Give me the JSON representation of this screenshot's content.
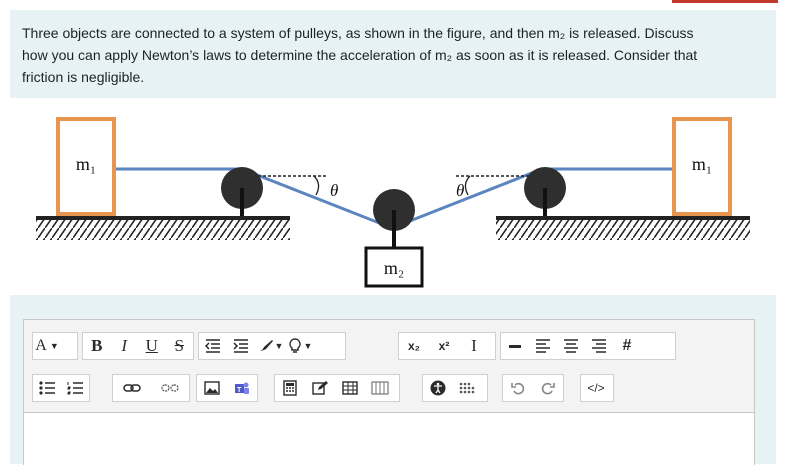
{
  "question": {
    "line1": "Three objects are connected to a system of pulleys, as shown in the figure, and then m₂ is released. Discuss",
    "line2": "how you can apply Newton’s laws to determine the acceleration of m₂ as soon as it is released. Consider that",
    "line3": "friction is negligible."
  },
  "figure": {
    "mass_left": "m₁",
    "mass_right": "m₁",
    "mass_center": "m₂",
    "angle_left": "θ",
    "angle_right": "θ",
    "colors": {
      "block_outline": "#e8964f",
      "rope": "#5b85c0",
      "pulley": "#2f2f2f"
    }
  },
  "toolbar": {
    "font_color_label": "A",
    "bold_label": "B",
    "italic_label": "I",
    "underline_label": "U",
    "strike_label": "S",
    "subscript_label": "x₂",
    "superscript_label": "x²",
    "clear_format_label": "I",
    "hash_label": "#",
    "html_label": "</>",
    "icons": [
      "font-color",
      "bold",
      "italic",
      "underline",
      "strikethrough",
      "outdent",
      "indent",
      "brush",
      "marker",
      "subscript",
      "superscript",
      "clear-formatting",
      "horizontal-rule",
      "align-left",
      "align-center",
      "align-right",
      "hashtag",
      "bullet-list",
      "numbered-list",
      "link",
      "unlink",
      "image",
      "teams",
      "calculator",
      "edit",
      "table",
      "columns",
      "accessibility",
      "special-chars",
      "undo",
      "redo",
      "html-source"
    ]
  }
}
